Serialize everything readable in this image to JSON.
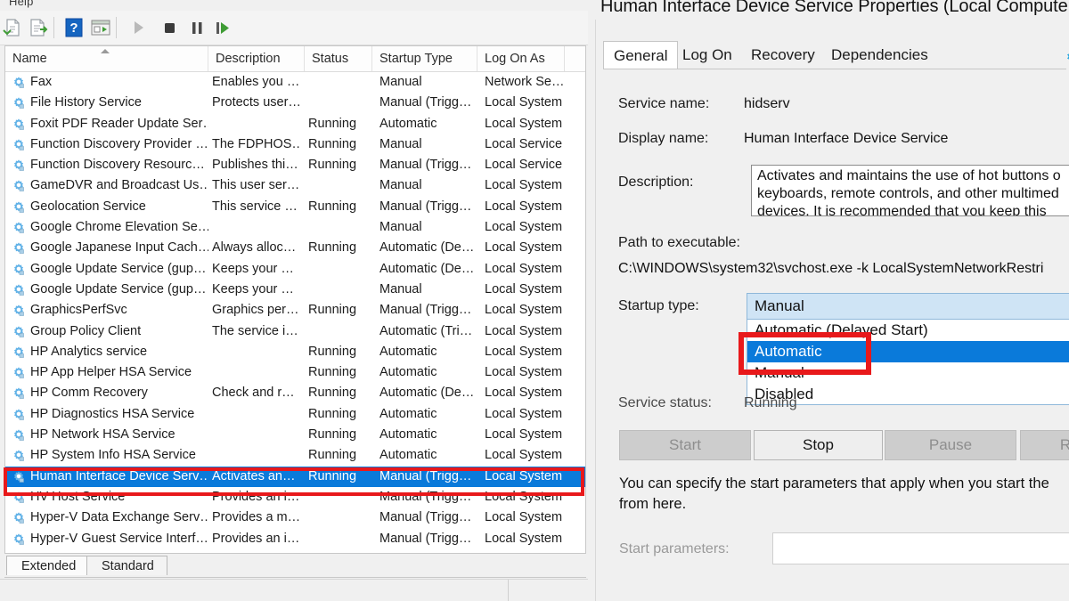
{
  "services_window": {
    "menu": {
      "help_label": "Help"
    },
    "toolbar": {
      "icons": [
        {
          "name": "export-list-icon",
          "glyph": "⇩"
        },
        {
          "name": "export-file-icon",
          "glyph": "⇨"
        },
        {
          "name": "help-icon",
          "glyph": "?"
        },
        {
          "name": "show-hide-console-tree-icon",
          "glyph": "▤"
        },
        {
          "name": "start-service-icon",
          "glyph": "▶"
        },
        {
          "name": "stop-service-icon",
          "glyph": "■"
        },
        {
          "name": "pause-service-icon",
          "glyph": "❚❚"
        },
        {
          "name": "restart-service-icon",
          "glyph": "▶|"
        }
      ]
    },
    "columns": [
      "Name",
      "Description",
      "Status",
      "Startup Type",
      "Log On As"
    ],
    "rows": [
      {
        "name": "Fax",
        "desc": "Enables you …",
        "status": "",
        "startup": "Manual",
        "logon": "Network Se…",
        "selected": false
      },
      {
        "name": "File History Service",
        "desc": "Protects user…",
        "status": "",
        "startup": "Manual (Trigg…",
        "logon": "Local System",
        "selected": false
      },
      {
        "name": "Foxit PDF Reader Update Ser…",
        "desc": "",
        "status": "Running",
        "startup": "Automatic",
        "logon": "Local System",
        "selected": false
      },
      {
        "name": "Function Discovery Provider …",
        "desc": "The FDPHOS…",
        "status": "Running",
        "startup": "Manual",
        "logon": "Local Service",
        "selected": false
      },
      {
        "name": "Function Discovery Resourc…",
        "desc": "Publishes thi…",
        "status": "Running",
        "startup": "Manual (Trigg…",
        "logon": "Local Service",
        "selected": false
      },
      {
        "name": "GameDVR and Broadcast Us…",
        "desc": "This user ser…",
        "status": "",
        "startup": "Manual",
        "logon": "Local System",
        "selected": false
      },
      {
        "name": "Geolocation Service",
        "desc": "This service …",
        "status": "Running",
        "startup": "Manual (Trigg…",
        "logon": "Local System",
        "selected": false
      },
      {
        "name": "Google Chrome Elevation Se…",
        "desc": "",
        "status": "",
        "startup": "Manual",
        "logon": "Local System",
        "selected": false
      },
      {
        "name": "Google Japanese Input Cach…",
        "desc": "Always alloc…",
        "status": "Running",
        "startup": "Automatic (De…",
        "logon": "Local System",
        "selected": false
      },
      {
        "name": "Google Update Service (gup…",
        "desc": "Keeps your …",
        "status": "",
        "startup": "Automatic (De…",
        "logon": "Local System",
        "selected": false
      },
      {
        "name": "Google Update Service (gup…",
        "desc": "Keeps your …",
        "status": "",
        "startup": "Manual",
        "logon": "Local System",
        "selected": false
      },
      {
        "name": "GraphicsPerfSvc",
        "desc": "Graphics per…",
        "status": "Running",
        "startup": "Manual (Trigg…",
        "logon": "Local System",
        "selected": false
      },
      {
        "name": "Group Policy Client",
        "desc": "The service i…",
        "status": "",
        "startup": "Automatic (Tri…",
        "logon": "Local System",
        "selected": false
      },
      {
        "name": "HP Analytics service",
        "desc": "",
        "status": "Running",
        "startup": "Automatic",
        "logon": "Local System",
        "selected": false
      },
      {
        "name": "HP App Helper HSA Service",
        "desc": "",
        "status": "Running",
        "startup": "Automatic",
        "logon": "Local System",
        "selected": false
      },
      {
        "name": "HP Comm Recovery",
        "desc": "Check and r…",
        "status": "Running",
        "startup": "Automatic (De…",
        "logon": "Local System",
        "selected": false
      },
      {
        "name": "HP Diagnostics HSA Service",
        "desc": "",
        "status": "Running",
        "startup": "Automatic",
        "logon": "Local System",
        "selected": false
      },
      {
        "name": "HP Network HSA Service",
        "desc": "",
        "status": "Running",
        "startup": "Automatic",
        "logon": "Local System",
        "selected": false
      },
      {
        "name": "HP System Info HSA Service",
        "desc": "",
        "status": "Running",
        "startup": "Automatic",
        "logon": "Local System",
        "selected": false
      },
      {
        "name": "Human Interface Device Serv…",
        "desc": "Activates an…",
        "status": "Running",
        "startup": "Manual (Trigg…",
        "logon": "Local System",
        "selected": true
      },
      {
        "name": "HV Host Service",
        "desc": "Provides an i…",
        "status": "",
        "startup": "Manual (Trigg…",
        "logon": "Local System",
        "selected": false
      },
      {
        "name": "Hyper-V Data Exchange Serv…",
        "desc": "Provides a m…",
        "status": "",
        "startup": "Manual (Trigg…",
        "logon": "Local System",
        "selected": false
      },
      {
        "name": "Hyper-V Guest Service Interf…",
        "desc": "Provides an i…",
        "status": "",
        "startup": "Manual (Trigg…",
        "logon": "Local System",
        "selected": false
      }
    ],
    "view_tabs": [
      {
        "label": "Extended",
        "active": false
      },
      {
        "label": "Standard",
        "active": true
      }
    ]
  },
  "properties_dialog": {
    "title": "Human Interface Device Service Properties (Local Computer)",
    "tabs": [
      {
        "label": "General",
        "active": true
      },
      {
        "label": "Log On",
        "active": false
      },
      {
        "label": "Recovery",
        "active": false
      },
      {
        "label": "Dependencies",
        "active": false
      }
    ],
    "fields": {
      "service_name_label": "Service name:",
      "service_name_value": "hidserv",
      "display_name_label": "Display name:",
      "display_name_value": "Human Interface Device Service",
      "description_label": "Description:",
      "description_lines": [
        "Activates and maintains the use of hot buttons o",
        "keyboards, remote controls, and other multimed",
        "devices. It is recommended that you keep this"
      ],
      "path_label": "Path to executable:",
      "path_value": "C:\\WINDOWS\\system32\\svchost.exe -k LocalSystemNetworkRestri",
      "startup_type_label": "Startup type:",
      "startup_type_value": "Manual",
      "service_status_label": "Service status:",
      "service_status_value": "Running",
      "start_parameters_label": "Start parameters:",
      "start_parameters_value": ""
    },
    "startup_type_options": [
      {
        "label": "Automatic (Delayed Start)",
        "highlighted": false
      },
      {
        "label": "Automatic",
        "highlighted": true
      },
      {
        "label": "Manual",
        "highlighted": false
      },
      {
        "label": "Disabled",
        "highlighted": false
      }
    ],
    "buttons": [
      {
        "label": "Start",
        "enabled": false
      },
      {
        "label": "Stop",
        "enabled": true
      },
      {
        "label": "Pause",
        "enabled": false
      },
      {
        "label": "Res",
        "enabled": false
      }
    ],
    "help_text_line1": "You can specify the start parameters that apply when you start the",
    "help_text_line2": "from here."
  },
  "annotations": {
    "selected_row_box_color": "#e8191b",
    "dropdown_option_box_color": "#e8191b"
  }
}
